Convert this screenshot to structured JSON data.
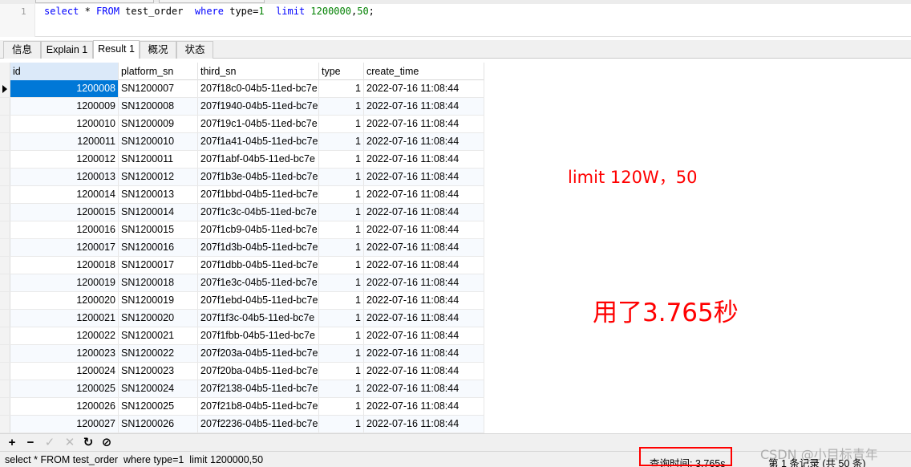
{
  "editor": {
    "line_number": "1",
    "tokens": {
      "select": "select",
      "star": " * ",
      "from": "FROM",
      "table": " test_order  ",
      "where": "where",
      "cond": " type=",
      "one": "1",
      "gap": "  ",
      "limit": "limit",
      "space": " ",
      "offset": "1200000",
      "comma": ",",
      "count": "50",
      "semi": ";"
    }
  },
  "tabs": [
    "信息",
    "Explain 1",
    "Result 1",
    "概况",
    "状态"
  ],
  "active_tab": "Result 1",
  "grid": {
    "columns": [
      "id",
      "platform_sn",
      "third_sn",
      "type",
      "create_time"
    ],
    "rows": [
      [
        "1200008",
        "SN1200007",
        "207f18c0-04b5-11ed-bc7e",
        "1",
        "2022-07-16 11:08:44"
      ],
      [
        "1200009",
        "SN1200008",
        "207f1940-04b5-11ed-bc7e",
        "1",
        "2022-07-16 11:08:44"
      ],
      [
        "1200010",
        "SN1200009",
        "207f19c1-04b5-11ed-bc7e",
        "1",
        "2022-07-16 11:08:44"
      ],
      [
        "1200011",
        "SN1200010",
        "207f1a41-04b5-11ed-bc7e",
        "1",
        "2022-07-16 11:08:44"
      ],
      [
        "1200012",
        "SN1200011",
        "207f1abf-04b5-11ed-bc7e",
        "1",
        "2022-07-16 11:08:44"
      ],
      [
        "1200013",
        "SN1200012",
        "207f1b3e-04b5-11ed-bc7e",
        "1",
        "2022-07-16 11:08:44"
      ],
      [
        "1200014",
        "SN1200013",
        "207f1bbd-04b5-11ed-bc7e",
        "1",
        "2022-07-16 11:08:44"
      ],
      [
        "1200015",
        "SN1200014",
        "207f1c3c-04b5-11ed-bc7e",
        "1",
        "2022-07-16 11:08:44"
      ],
      [
        "1200016",
        "SN1200015",
        "207f1cb9-04b5-11ed-bc7e",
        "1",
        "2022-07-16 11:08:44"
      ],
      [
        "1200017",
        "SN1200016",
        "207f1d3b-04b5-11ed-bc7e",
        "1",
        "2022-07-16 11:08:44"
      ],
      [
        "1200018",
        "SN1200017",
        "207f1dbb-04b5-11ed-bc7e",
        "1",
        "2022-07-16 11:08:44"
      ],
      [
        "1200019",
        "SN1200018",
        "207f1e3c-04b5-11ed-bc7e",
        "1",
        "2022-07-16 11:08:44"
      ],
      [
        "1200020",
        "SN1200019",
        "207f1ebd-04b5-11ed-bc7e",
        "1",
        "2022-07-16 11:08:44"
      ],
      [
        "1200021",
        "SN1200020",
        "207f1f3c-04b5-11ed-bc7e",
        "1",
        "2022-07-16 11:08:44"
      ],
      [
        "1200022",
        "SN1200021",
        "207f1fbb-04b5-11ed-bc7e",
        "1",
        "2022-07-16 11:08:44"
      ],
      [
        "1200023",
        "SN1200022",
        "207f203a-04b5-11ed-bc7e",
        "1",
        "2022-07-16 11:08:44"
      ],
      [
        "1200024",
        "SN1200023",
        "207f20ba-04b5-11ed-bc7e",
        "1",
        "2022-07-16 11:08:44"
      ],
      [
        "1200025",
        "SN1200024",
        "207f2138-04b5-11ed-bc7e",
        "1",
        "2022-07-16 11:08:44"
      ],
      [
        "1200026",
        "SN1200025",
        "207f21b8-04b5-11ed-bc7e",
        "1",
        "2022-07-16 11:08:44"
      ],
      [
        "1200027",
        "SN1200026",
        "207f2236-04b5-11ed-bc7e",
        "1",
        "2022-07-16 11:08:44"
      ]
    ]
  },
  "annotations": {
    "note1": "limit 120W，50",
    "note2": "用了3.765秒",
    "color": "#ff0000"
  },
  "toolbar": {
    "icons": [
      "plus-icon",
      "minus-icon",
      "check-icon",
      "cross-icon",
      "refresh-icon",
      "stop-icon"
    ],
    "glyphs": [
      "+",
      "−",
      "✓",
      "✕",
      "↻",
      "⊘"
    ]
  },
  "status": {
    "sql": "select * FROM test_order  where type=1  limit 1200000,50",
    "query_time": "查询时间: 3.765s",
    "record_info": "第 1 条记录 (共 50 条)"
  },
  "watermark": "CSDN @小目标青年",
  "colors": {
    "selection": "#0078d7",
    "header_highlight": "#dbe9f9",
    "keyword": "#0000ff",
    "number": "#008000"
  }
}
